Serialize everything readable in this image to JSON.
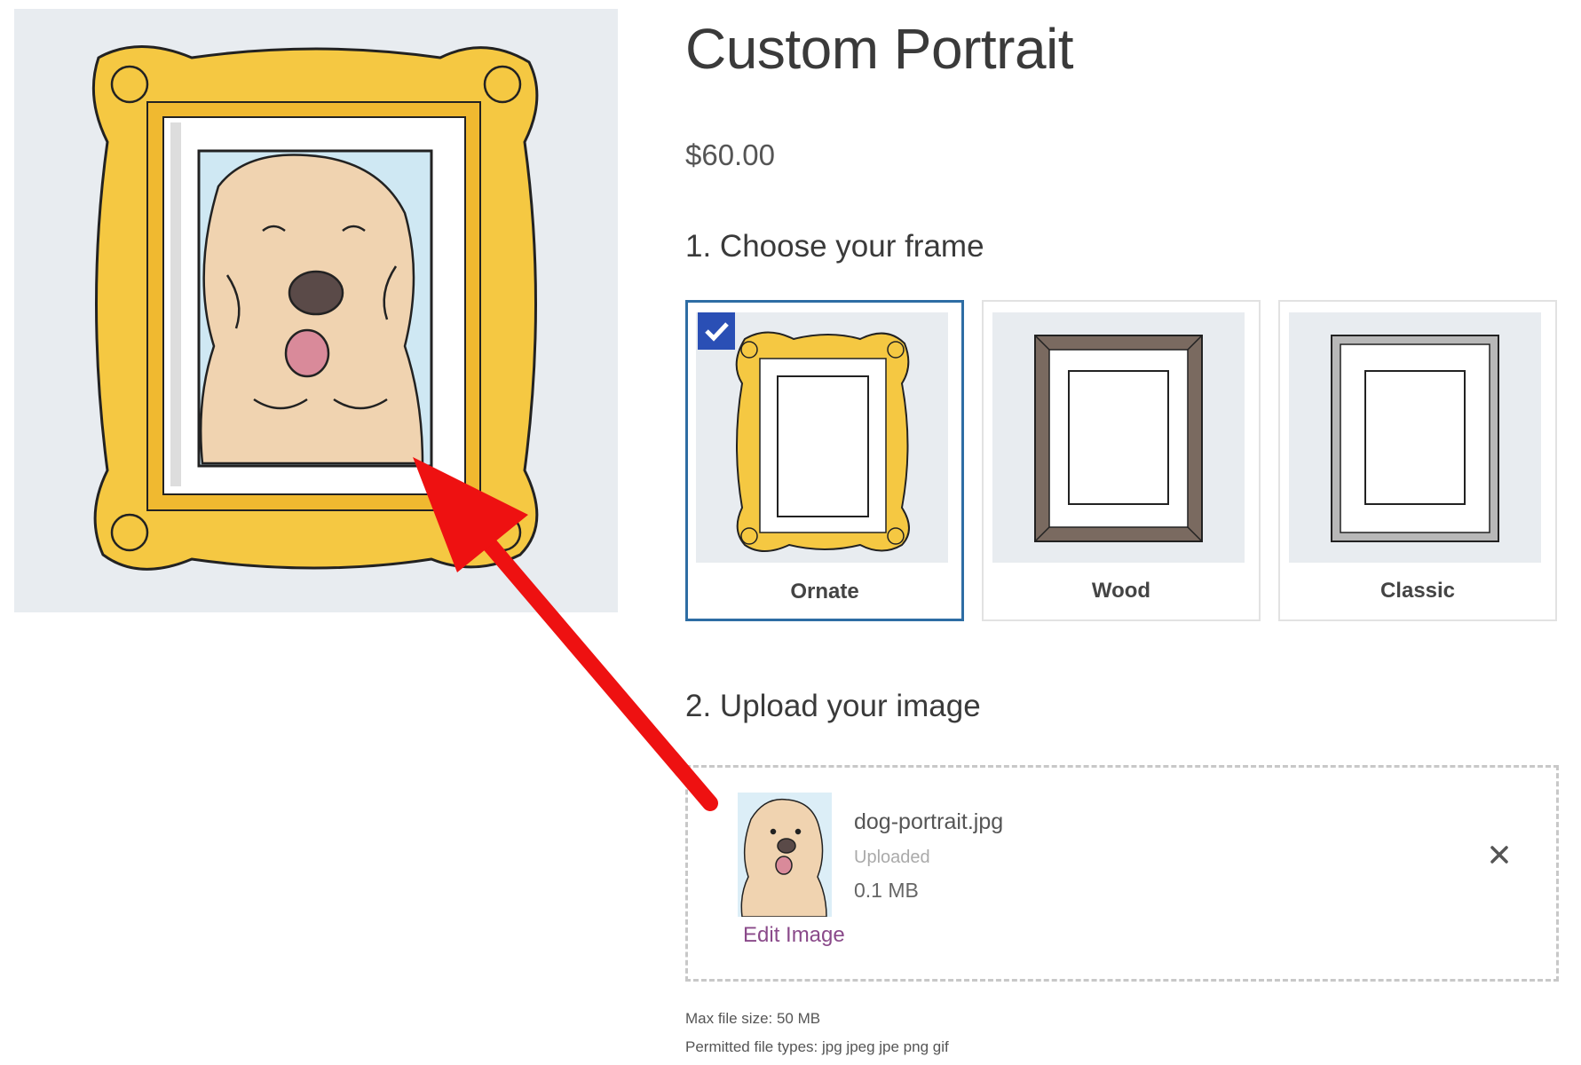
{
  "product": {
    "title": "Custom Portrait",
    "price": "$60.00"
  },
  "product_image_icon": "dog-portrait-in-ornate-frame",
  "colors": {
    "accent_blue": "#2e6da4",
    "check_blue": "#2a4fb5",
    "gold_frame": "#f5c842",
    "wood_frame": "#7a6a60",
    "classic_frame": "#b8b8b8",
    "arrow_red": "#ee1111",
    "link_purple": "#8a4a8a"
  },
  "frame_section": {
    "heading": "1. Choose your frame",
    "options": [
      {
        "label": "Ornate",
        "selected": true,
        "icon": "ornate-frame-icon"
      },
      {
        "label": "Wood",
        "selected": false,
        "icon": "wood-frame-icon"
      },
      {
        "label": "Classic",
        "selected": false,
        "icon": "classic-frame-icon"
      }
    ]
  },
  "upload_section": {
    "heading": "2. Upload your image",
    "file": {
      "name": "dog-portrait.jpg",
      "status": "Uploaded",
      "size": "0.1 MB",
      "edit_label": "Edit Image",
      "remove_icon": "close-icon"
    },
    "max_size_note": "Max file size: 50 MB",
    "permitted_types_note": "Permitted file types: jpg jpeg jpe png gif"
  }
}
